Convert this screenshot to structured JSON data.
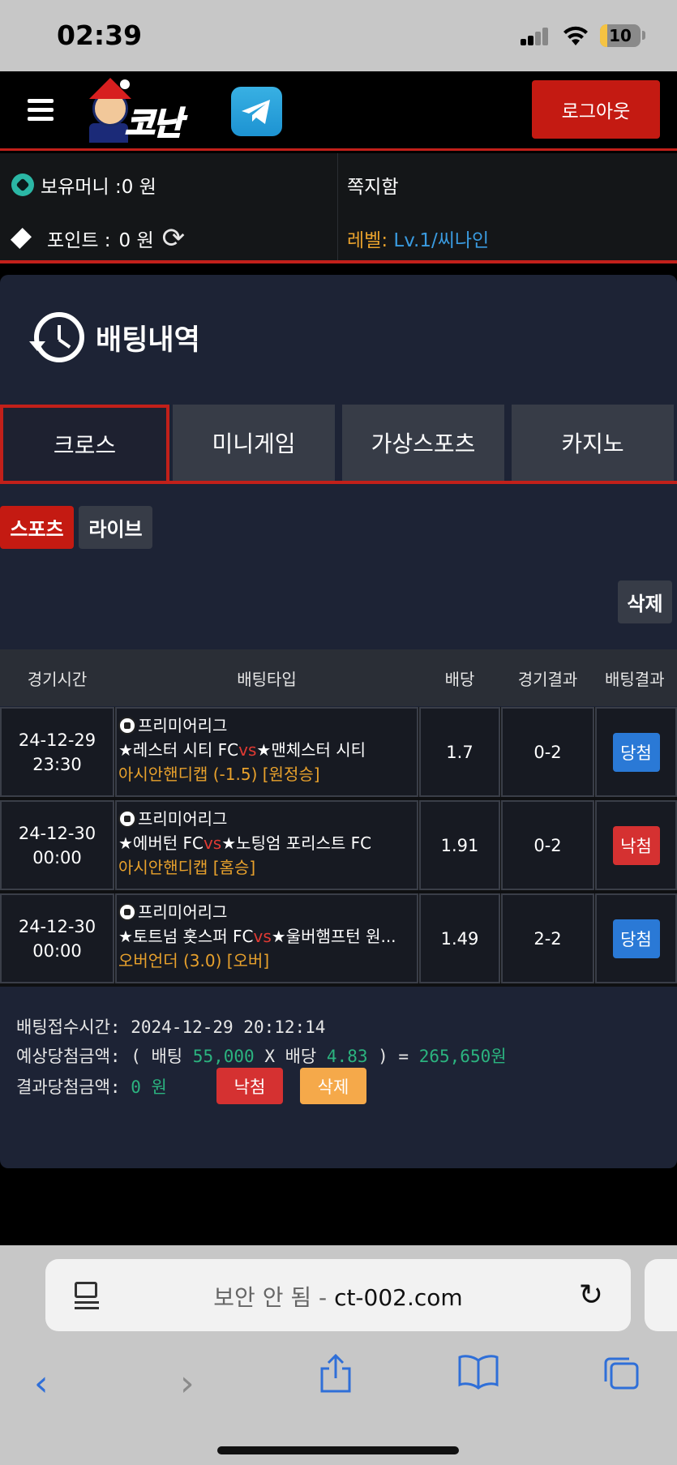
{
  "status": {
    "time": "02:39",
    "battery": "10",
    "battery_level": 0.1
  },
  "header": {
    "logo_text": "코난",
    "logout_label": "로그아웃"
  },
  "info": {
    "money_label": "보유머니 :0 원",
    "notes_label": "쪽지함",
    "points_label": "포인트 :",
    "points_value": "0 원",
    "level_label": "레벨:",
    "level_value": "Lv.1/씨나인"
  },
  "page": {
    "title": "배팅내역"
  },
  "tabs": [
    "크로스",
    "미니게임",
    "가상스포츠",
    "카지노"
  ],
  "subtabs": {
    "sports": "스포츠",
    "live": "라이브"
  },
  "delete_label": "삭제",
  "table": {
    "headers": [
      "경기시간",
      "배팅타입",
      "배당",
      "경기결과",
      "배팅결과"
    ],
    "rows": [
      {
        "date": "24-12-29",
        "time": "23:30",
        "league": "프리미어리그",
        "home": "★레스터 시티 FC",
        "vs": "vs",
        "away": "★맨체스터 시티",
        "bet": "아시안핸디캡 (-1.5) [원정승]",
        "odds": "1.7",
        "score": "0-2",
        "result": "당첨",
        "result_color": "#2a79d6"
      },
      {
        "date": "24-12-30",
        "time": "00:00",
        "league": "프리미어리그",
        "home": "★에버턴 FC",
        "vs": "vs",
        "away": "★노팅엄 포리스트 FC",
        "bet": "아시안핸디캡 [홈승]",
        "odds": "1.91",
        "score": "0-2",
        "result": "낙첨",
        "result_color": "#d53131"
      },
      {
        "date": "24-12-30",
        "time": "00:00",
        "league": "프리미어리그",
        "home": "★토트넘 홋스퍼 FC",
        "vs": "vs",
        "away": "★울버햄프턴 원...",
        "bet": "오버언더 (3.0) [오버]",
        "odds": "1.49",
        "score": "2-2",
        "result": "당첨",
        "result_color": "#2a79d6"
      }
    ]
  },
  "summary": {
    "received_label": "배팅접수시간:",
    "received_value": "2024-12-29 20:12:14",
    "expected_label": "예상당첨금액: ( 배팅",
    "bet_amount": "55,000",
    "x_odds": "X 배당",
    "odds_total": "4.83",
    "eq": ") =",
    "expected_value": "265,650원",
    "result_label": "결과당첨금액:",
    "result_value": "0 원",
    "lose_label": "낙첨",
    "delete_label": "삭제"
  },
  "browser": {
    "url_prefix": "보안 안 됨 -",
    "url": "ct-002.com"
  }
}
